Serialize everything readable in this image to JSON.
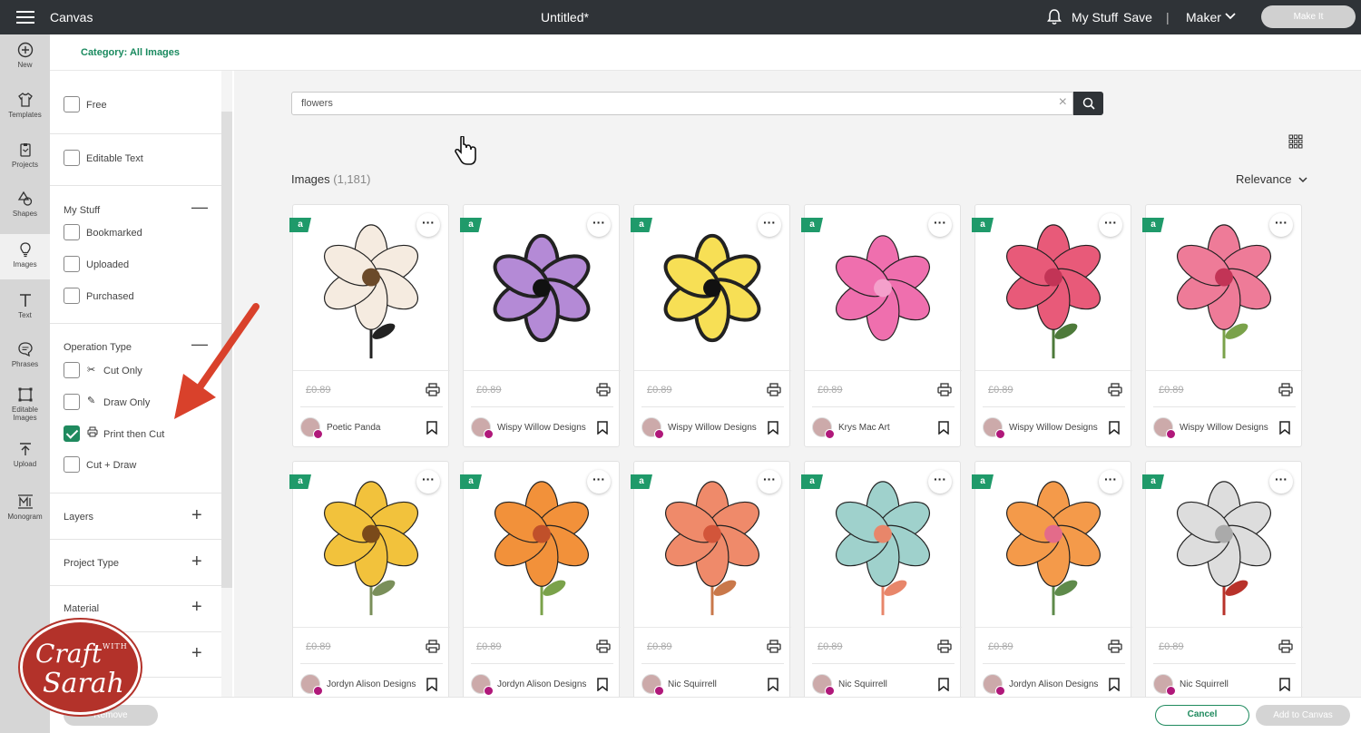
{
  "topbar": {
    "app_title": "Canvas",
    "doc_title": "Untitled*",
    "my_stuff": "My Stuff",
    "save": "Save",
    "separator": "|",
    "machine": "Maker",
    "make_it": "Make It"
  },
  "rail": {
    "items": [
      {
        "label": "New",
        "icon": "plus-circle-icon"
      },
      {
        "label": "Templates",
        "icon": "shirt-icon"
      },
      {
        "label": "Projects",
        "icon": "clipboard-icon"
      },
      {
        "label": "Shapes",
        "icon": "shapes-icon"
      },
      {
        "label": "Images",
        "icon": "lightbulb-icon"
      },
      {
        "label": "Text",
        "icon": "text-icon"
      },
      {
        "label": "Phrases",
        "icon": "speech-bubble-icon"
      },
      {
        "label": "Editable Images",
        "icon": "editable-image-icon"
      },
      {
        "label": "Upload",
        "icon": "upload-icon"
      },
      {
        "label": "Monogram",
        "icon": "monogram-icon"
      }
    ],
    "active": "Images"
  },
  "category": {
    "label": "Category: All Images"
  },
  "filters": {
    "free": "Free",
    "editable_text": "Editable Text",
    "my_stuff": {
      "title": "My Stuff",
      "options": [
        "Bookmarked",
        "Uploaded",
        "Purchased"
      ]
    },
    "operation_type": {
      "title": "Operation Type",
      "options": [
        {
          "label": "Cut Only",
          "checked": false
        },
        {
          "label": "Draw Only",
          "checked": false
        },
        {
          "label": "Print then Cut",
          "checked": true
        },
        {
          "label": "Cut + Draw",
          "checked": false
        }
      ]
    },
    "collapsed": [
      "Layers",
      "Project Type",
      "Material"
    ]
  },
  "search": {
    "value": "flowers",
    "placeholder": "Search"
  },
  "results": {
    "label": "Images",
    "count": "(1,181)"
  },
  "sort": {
    "label": "Relevance"
  },
  "cards": [
    {
      "price": "£0.89",
      "designer": "Poetic Panda",
      "badge": "a"
    },
    {
      "price": "£0.89",
      "designer": "Wispy Willow Designs",
      "badge": "a"
    },
    {
      "price": "£0.89",
      "designer": "Wispy Willow Designs",
      "badge": "a"
    },
    {
      "price": "£0.89",
      "designer": "Krys Mac Art",
      "badge": "a"
    },
    {
      "price": "£0.89",
      "designer": "Wispy Willow Designs",
      "badge": "a"
    },
    {
      "price": "£0.89",
      "designer": "Wispy Willow Designs",
      "badge": "a"
    },
    {
      "price": "£0.89",
      "designer": "Jordyn Alison Designs",
      "badge": "a"
    },
    {
      "price": "£0.89",
      "designer": "Jordyn Alison Designs",
      "badge": "a"
    },
    {
      "price": "£0.89",
      "designer": "Nic Squirrell",
      "badge": "a"
    },
    {
      "price": "£0.89",
      "designer": "Nic Squirrell",
      "badge": "a"
    },
    {
      "price": "£0.89",
      "designer": "Jordyn Alison Designs",
      "badge": "a"
    },
    {
      "price": "£0.89",
      "designer": "Nic Squirrell",
      "badge": "a"
    }
  ],
  "bottombar": {
    "remove": "Remove",
    "cancel": "Cancel",
    "add_to_canvas": "Add to Canvas"
  },
  "watermark": {
    "line1": "Craft",
    "line2": "WITH",
    "line3": "Sarah"
  },
  "colors": {
    "accent": "#1f8a5e",
    "topbar": "#2f3337",
    "annotation": "#d9412b"
  }
}
